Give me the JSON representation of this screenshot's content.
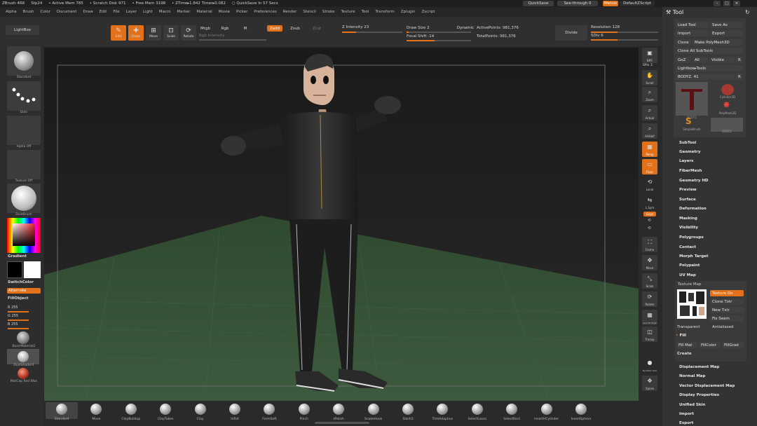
{
  "title_bar": {
    "segments": [
      "ZBrush 4R6",
      "Stp24",
      "• Active Mem 785",
      "• Scratch Disk 971",
      "• Free Mem 3198",
      "• ZTime▸1.842 Timer▸0.082",
      "○ QuickSave In 57 Secs"
    ],
    "quicksave": "QuickSave",
    "see_through": "See-through   0",
    "menus": "Menus",
    "default_zscript": "DefaultZScript"
  },
  "menu_bar": [
    "Alpha",
    "Brush",
    "Color",
    "Document",
    "Draw",
    "Edit",
    "File",
    "Layer",
    "Light",
    "Macro",
    "Marker",
    "Material",
    "Movie",
    "Picker",
    "Preferences",
    "Render",
    "Stencil",
    "Stroke",
    "Texture",
    "Tool",
    "Transform",
    "Zplugin",
    "Zscript"
  ],
  "top_toolbar": {
    "lightbox": "LightBox",
    "edit": "Edit",
    "draw": "Draw",
    "move": "Move",
    "scale": "Scale",
    "rotate": "Rotate",
    "mrgb": "Mrgb",
    "rgb": "Rgb",
    "m": "M",
    "rgb_intensity": "Rgb Intensity",
    "zadd": "Zadd",
    "zsub": "Zsub",
    "zcut": "Zcut",
    "z_intensity": "Z Intensity 23",
    "draw_size": "Draw Size 2",
    "dynamic": "Dynamic",
    "focal_shift": "Focal Shift -14",
    "active_points": "ActivePoints: 981,376",
    "total_points": "TotalPoints: 981,376",
    "divide": "Divide",
    "resolution": "Resolution 128",
    "sdiv": "SDiv 6",
    "z_intensity_value": 23,
    "draw_size_value": 2,
    "focal_shift_value": -14
  },
  "left_panel": {
    "thumbs": [
      "Standard",
      "Dots",
      "Alpha Off",
      "Texture Off",
      "DustBrush"
    ],
    "gradient": "Gradient",
    "switch_color": "SwitchColor",
    "alternate": "Alternate",
    "fill_object": "FillObject",
    "r_label": "R 255",
    "g_label": "G 255",
    "b_label": "B 255",
    "material1": "BasicMaterial2",
    "material2": "DustShader4",
    "matcap": "MatCap Red Wax"
  },
  "right_shelf": [
    "BPR",
    "SPix 3",
    "Scroll",
    "Zoom",
    "Actual",
    "AAHalf",
    "Persp",
    "Floor",
    "Local",
    "L.Sym",
    "Gxyz",
    "Frame",
    "Move",
    "Scale",
    "Rotate",
    "Line Fill PolyF",
    "Transp",
    "Dynamic Solo",
    "Xpose"
  ],
  "tool_panel": {
    "title": "Tool",
    "load_tool": "Load Tool",
    "save_as": "Save As",
    "import": "Import",
    "export": "Export",
    "clone": "Clone",
    "make_polymesh": "Make PolyMesh3D",
    "clone_all": "Clone All SubTools",
    "goz": "GoZ",
    "all": "All",
    "visible": "Visible",
    "r": "R",
    "lightbox_tools": "Lightbox▸Tools",
    "bodyz": "BODYZ. 41",
    "tool_thumbs": [
      "BODYZ",
      "Cylinder3D",
      "PolyMesh3D",
      "SimpleBrush",
      "BODYZ"
    ],
    "sections_a": [
      "SubTool",
      "Geometry",
      "Layers",
      "FiberMesh",
      "Geometry HD",
      "Preview",
      "Surface",
      "Deformation",
      "Masking",
      "Visibility",
      "Polygroups",
      "Contact",
      "Morph Target",
      "Polypaint",
      "UV Map"
    ],
    "texture_map": "Texture Map",
    "texture_on": "Texture On",
    "clone_txtr": "Clone Txtr",
    "new_txtr": "New Txtr",
    "fix_seam": "Fix Seam",
    "transparent": "Transparent",
    "antialiased": "Antialiased",
    "fill": "Fill",
    "fill_mat": "Fill Mat",
    "fill_color": "FillColor",
    "fill_grad": "FillGrad",
    "create": "Create",
    "sections_b": [
      "Displacement Map",
      "Normal Map",
      "Vector Displacement Map",
      "Display Properties",
      "Unified Skin",
      "Import",
      "Export"
    ]
  },
  "bottom_shelf": [
    "Standard",
    "Move",
    "ClayBuildup",
    "ClayTubes",
    "Clay",
    "Inflat",
    "FormSoft",
    "Pinch",
    "zPolish",
    "SnakeHook",
    "Slash3",
    "TrimAdaptive",
    "SelectLasso",
    "SelectRect",
    "InsertHCylinder",
    "InsertSphere"
  ]
}
